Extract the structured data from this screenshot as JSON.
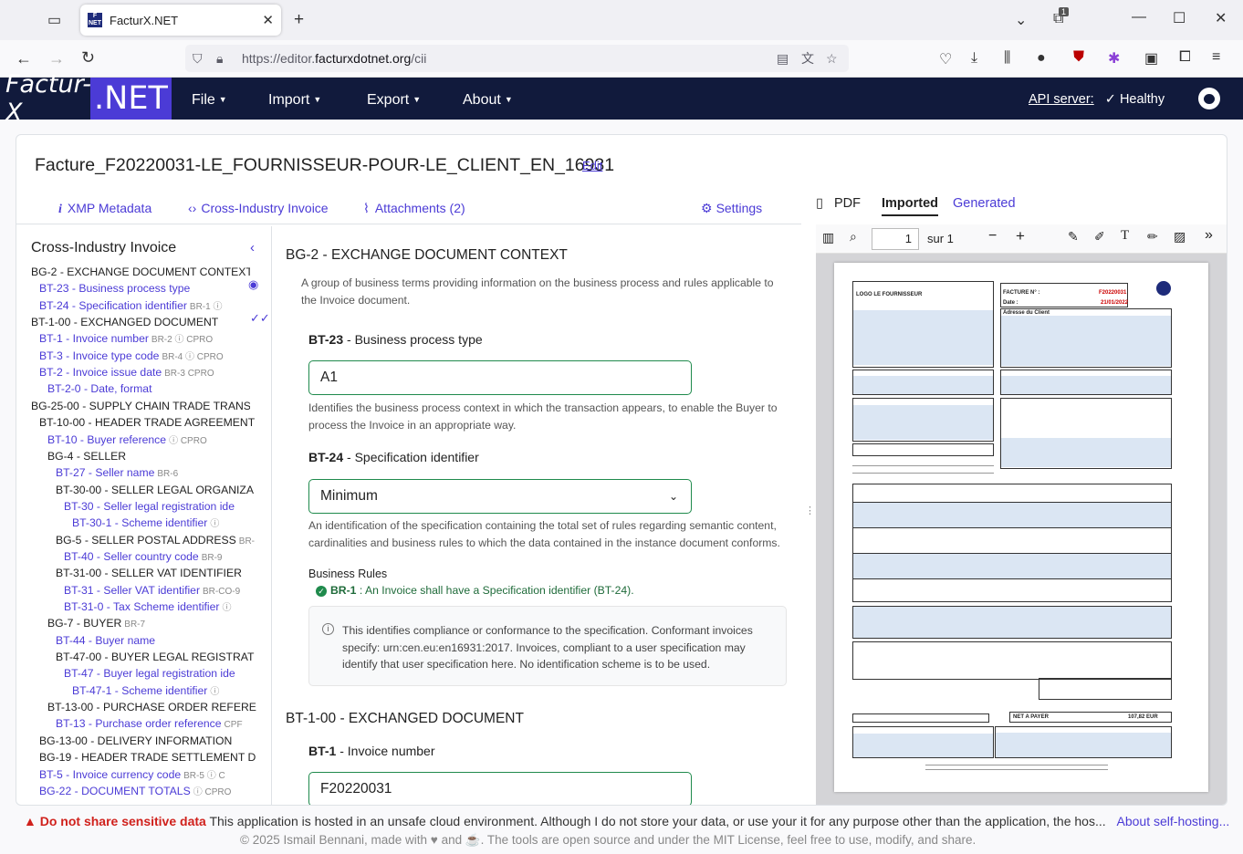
{
  "browser": {
    "tab_title": "FacturX.NET",
    "url_prefix": "https://editor.",
    "url_domain": "facturxdotnet.org",
    "url_path": "/cii",
    "tab_count_badge": "1"
  },
  "app": {
    "logo_left": "Factur-X",
    "logo_right": ".NET",
    "menus": [
      "File",
      "Import",
      "Export",
      "About"
    ],
    "api_label": "API server:",
    "api_status": "Healthy"
  },
  "document": {
    "title": "Facture_F20220031-LE_FOURNISSEUR-POUR-LE_CLIENT_EN_16931",
    "edit": "Edit"
  },
  "left_tabs": {
    "xmp": "XMP Metadata",
    "cii": "Cross-Industry Invoice",
    "attachments": "Attachments (2)",
    "settings": "Settings"
  },
  "sidebar": {
    "title": "Cross-Industry Invoice",
    "rows": [
      {
        "code": "BG-2",
        "label": " - EXCHANGE DOCUMENT CONTEXT",
        "tag": "",
        "group": true
      },
      {
        "code": "BT-23",
        "label": " - Business process type",
        "tag": "",
        "group": false
      },
      {
        "code": "BT-24",
        "label": " - Specification identifier",
        "tag": "BR-1 ⓘ",
        "group": false
      },
      {
        "code": "BT-1-00",
        "label": " - EXCHANGED DOCUMENT",
        "tag": "",
        "group": true
      },
      {
        "code": "BT-1",
        "label": " - Invoice number",
        "tag": "BR-2 ⓘ CPRO",
        "group": false
      },
      {
        "code": "BT-3",
        "label": " - Invoice type code",
        "tag": "BR-4 ⓘ CPRO",
        "group": false
      },
      {
        "code": "BT-2",
        "label": " - Invoice issue date",
        "tag": "BR-3 CPRO",
        "group": false
      },
      {
        "code": "BT-2-0",
        "label": " - Date, format",
        "tag": "",
        "group": false
      },
      {
        "code": "BG-25-00",
        "label": " - SUPPLY CHAIN TRADE TRANS",
        "tag": "",
        "group": true
      },
      {
        "code": "BT-10-00",
        "label": " - HEADER TRADE AGREEMENT",
        "tag": "",
        "group": true
      },
      {
        "code": "BT-10",
        "label": " - Buyer reference",
        "tag": "ⓘ CPRO",
        "group": false
      },
      {
        "code": "BG-4",
        "label": " - SELLER",
        "tag": "",
        "group": true
      },
      {
        "code": "BT-27",
        "label": " - Seller name",
        "tag": "BR-6",
        "group": false
      },
      {
        "code": "BT-30-00",
        "label": " - SELLER LEGAL ORGANIZA",
        "tag": "",
        "group": true
      },
      {
        "code": "BT-30",
        "label": " - Seller legal registration ide",
        "tag": "",
        "group": false
      },
      {
        "code": "BT-30-1",
        "label": " - Scheme identifier",
        "tag": "ⓘ",
        "group": false
      },
      {
        "code": "BG-5",
        "label": " - SELLER POSTAL ADDRESS",
        "tag": "BR-",
        "group": true
      },
      {
        "code": "BT-40",
        "label": " - Seller country code",
        "tag": "BR-9",
        "group": false
      },
      {
        "code": "BT-31-00",
        "label": " - SELLER VAT IDENTIFIER",
        "tag": "",
        "group": true
      },
      {
        "code": "BT-31",
        "label": " - Seller VAT identifier",
        "tag": "BR-CO-9",
        "group": false
      },
      {
        "code": "BT-31-0",
        "label": " - Tax Scheme identifier",
        "tag": "ⓘ",
        "group": false
      },
      {
        "code": "BG-7",
        "label": " - BUYER",
        "tag": "BR-7",
        "group": true
      },
      {
        "code": "BT-44",
        "label": " - Buyer name",
        "tag": "",
        "group": false
      },
      {
        "code": "BT-47-00",
        "label": " - BUYER LEGAL REGISTRAT",
        "tag": "",
        "group": true
      },
      {
        "code": "BT-47",
        "label": " - Buyer legal registration ide",
        "tag": "",
        "group": false
      },
      {
        "code": "BT-47-1",
        "label": " - Scheme identifier",
        "tag": "ⓘ",
        "group": false
      },
      {
        "code": "BT-13-00",
        "label": " - PURCHASE ORDER REFERE",
        "tag": "",
        "group": true
      },
      {
        "code": "BT-13",
        "label": " - Purchase order reference",
        "tag": "CPF",
        "group": false
      },
      {
        "code": "BG-13-00",
        "label": " - DELIVERY INFORMATION",
        "tag": "",
        "group": true
      },
      {
        "code": "BG-19",
        "label": " - HEADER TRADE SETTLEMENT D",
        "tag": "",
        "group": true
      },
      {
        "code": "BT-5",
        "label": " - Invoice currency code",
        "tag": "BR-5 ⓘ C",
        "group": false
      },
      {
        "code": "BG-22",
        "label": " - DOCUMENT TOTALS",
        "tag": "ⓘ CPRO",
        "group": false
      }
    ]
  },
  "main": {
    "sec1": "BG-2 - EXCHANGE DOCUMENT CONTEXT",
    "sec1_desc": "A group of business terms providing information on the business process and rules applicable to the Invoice document.",
    "bt23_code": "BT-23",
    "bt23_label": " - Business process type",
    "bt23_value": "A1",
    "bt23_desc": "Identifies the business process context in which the transaction appears, to enable the Buyer to process the Invoice in an appropriate way.",
    "bt24_code": "BT-24",
    "bt24_label": " - Specification identifier",
    "bt24_value": "Minimum",
    "bt24_desc": "An identification of the specification containing the total set of rules regarding semantic content, cardinalities and business rules to which the data contained in the instance document conforms.",
    "rules_title": "Business Rules",
    "rule_code": "BR-1",
    "rule_text": " : An Invoice shall have a Specification identifier (BT-24).",
    "info": "This identifies compliance or conformance to the specification. Conformant invoices specify: urn:cen.eu:en16931:2017. Invoices, compliant to a user specification may identify that user specification here. No identification scheme is to be used.",
    "sec2": "BT-1-00 - EXCHANGED DOCUMENT",
    "bt1_code": "BT-1",
    "bt1_label": " - Invoice number",
    "bt1_value": "F20220031"
  },
  "pdf": {
    "label": "PDF",
    "tab_imported": "Imported",
    "tab_generated": "Generated",
    "page_num": "1",
    "page_of": "sur 1",
    "page_texts": {
      "seller": "LOGO LE FOURNISSEUR",
      "invoice_label": "FACTURE N° :",
      "invoice_no": "F20220031",
      "date_label": "Date :",
      "date": "21/01/2022",
      "client": "Adresse du Client",
      "total_label": "NET A PAYER",
      "total": "107,82 EUR"
    }
  },
  "footer": {
    "warn_title": "Do not share sensitive data",
    "warn_text": " This application is hosted in an unsafe cloud environment. Although I do not store your data, or use your it for any purpose other than the application, the hos...",
    "warn_link": "About self-hosting...",
    "copyright": "© 2025 Ismail Bennani, made with ♥ and ☕. The tools are open source and under the MIT License, feel free to use, modify, and share."
  }
}
